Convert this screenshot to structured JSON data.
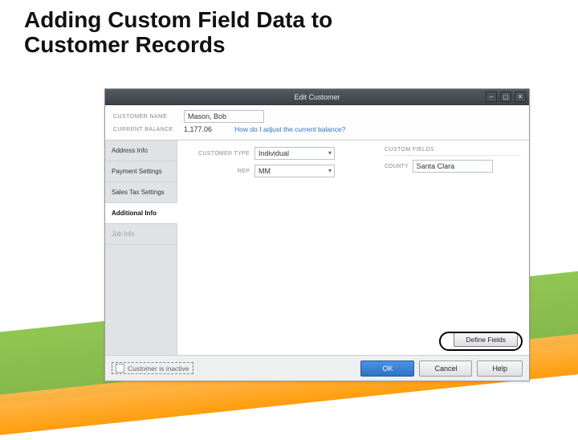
{
  "slide": {
    "title": "Adding Custom Field Data to Customer Records"
  },
  "window": {
    "title": "Edit Customer"
  },
  "header": {
    "name_label": "CUSTOMER NAME",
    "name_value": "Mason, Bob",
    "balance_label": "CURRENT BALANCE",
    "balance_value": "1,177.06",
    "adjust_link": "How do I adjust the current balance?"
  },
  "tabs": {
    "address": "Address Info",
    "payment": "Payment Settings",
    "sales_tax": "Sales Tax Settings",
    "additional": "Additional Info",
    "job": "Job Info"
  },
  "form": {
    "customer_type_label": "CUSTOMER TYPE",
    "customer_type_value": "Individual",
    "rep_label": "REP",
    "rep_value": "MM"
  },
  "custom_fields": {
    "section": "CUSTOM FIELDS",
    "county_label": "COUNTY",
    "county_value": "Santa Clara",
    "define_button": "Define Fields"
  },
  "footer": {
    "inactive": "Customer is inactive",
    "ok": "OK",
    "cancel": "Cancel",
    "help": "Help"
  }
}
